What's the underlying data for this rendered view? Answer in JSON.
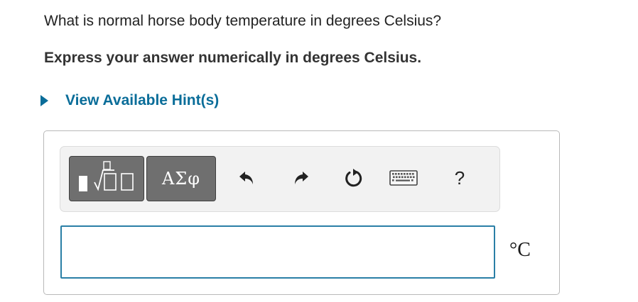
{
  "question": {
    "text": "What is normal horse body temperature in degrees Celsius?",
    "instruction": "Express your answer numerically in degrees Celsius."
  },
  "hint": {
    "label": "View Available Hint(s)",
    "icon": "triangle-right-icon",
    "color": "#0a6d99"
  },
  "toolbar": {
    "templates_button_icon": "templates-icon",
    "symbols_button_label": "ΑΣφ",
    "undo_icon": "undo-icon",
    "redo_icon": "redo-icon",
    "reset_icon": "reset-icon",
    "keyboard_icon": "keyboard-icon",
    "help_label": "?"
  },
  "answer": {
    "value": "",
    "unit": "°C",
    "border_color": "#2a7fa6"
  }
}
